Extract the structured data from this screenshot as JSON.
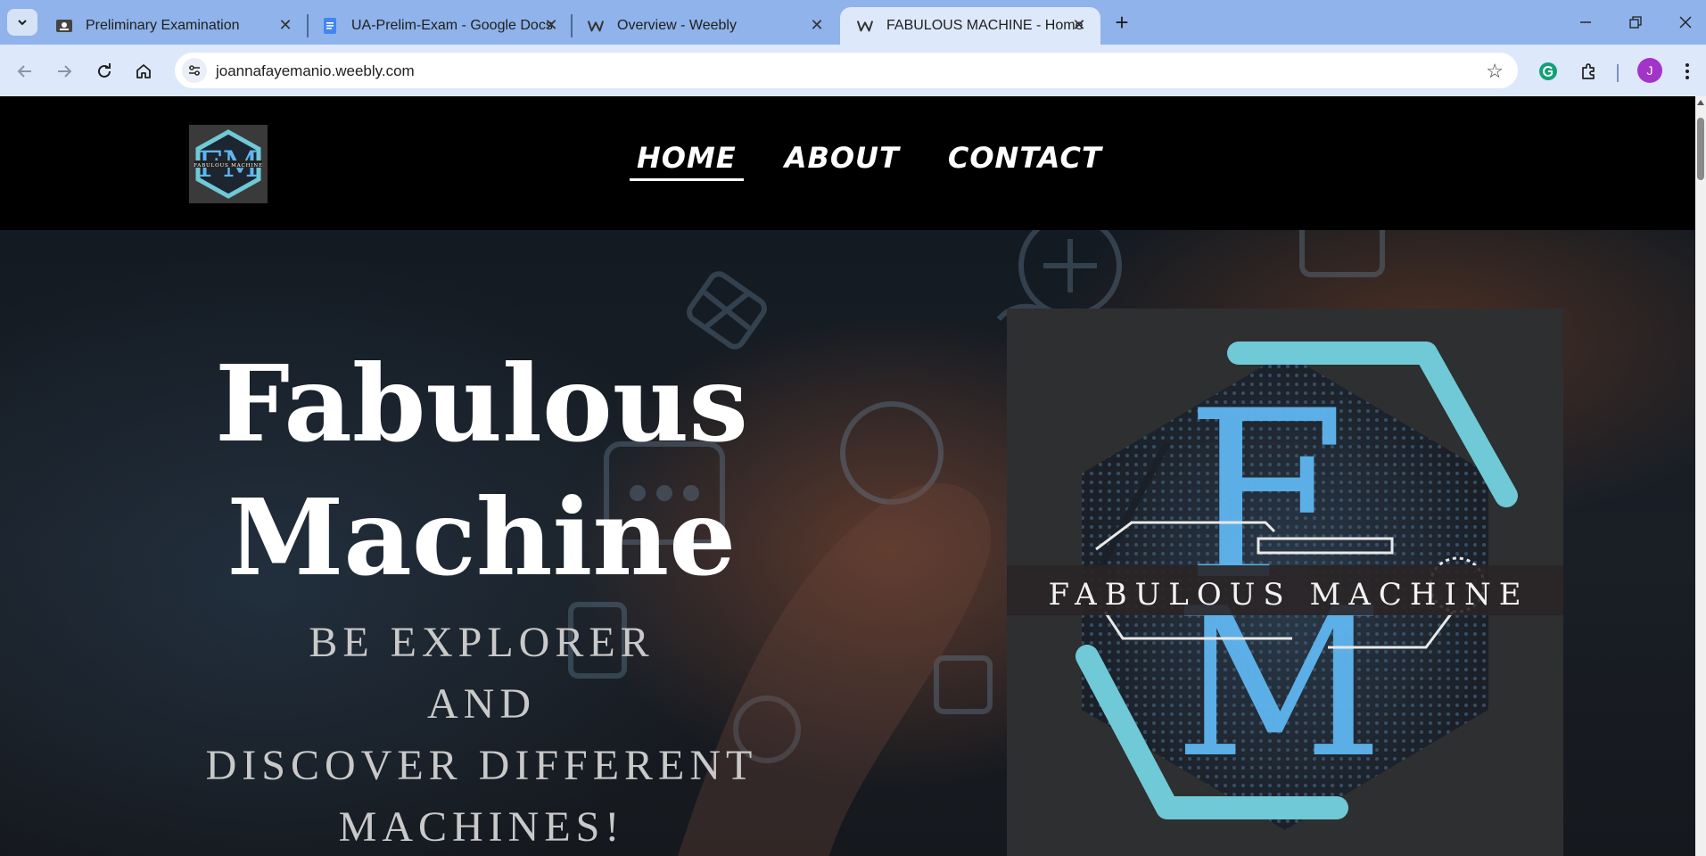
{
  "browser": {
    "tabs": [
      {
        "title": "Preliminary Examination",
        "icon": "classroom-icon"
      },
      {
        "title": "UA-Prelim-Exam - Google Docs",
        "icon": "google-docs-icon"
      },
      {
        "title": "Overview - Weebly",
        "icon": "weebly-icon"
      },
      {
        "title": "FABULOUS MACHINE - Home",
        "icon": "weebly-icon",
        "active": true
      }
    ],
    "url": "joannafayemanio.weebly.com",
    "profile_initial": "J",
    "colors": {
      "tabstrip": "#8fb3ea",
      "toolbar": "#dde8fb",
      "profile": "#a334c9"
    }
  },
  "site": {
    "nav": [
      {
        "label": "HOME",
        "active": true
      },
      {
        "label": "ABOUT"
      },
      {
        "label": "CONTACT"
      }
    ],
    "hero": {
      "title_line1": "Fabulous",
      "title_line2": "Machine",
      "subtitle_line1": "BE EXPLORER",
      "subtitle_line2": "AND",
      "subtitle_line3": "DISCOVER DIFFERENT",
      "subtitle_line4": "MACHINES!"
    },
    "logo": {
      "monogram": "FM",
      "banner_text": "FABULOUS MACHINE",
      "accent_color": "#6fc9d6",
      "glow_color": "#5fb6f0"
    }
  }
}
